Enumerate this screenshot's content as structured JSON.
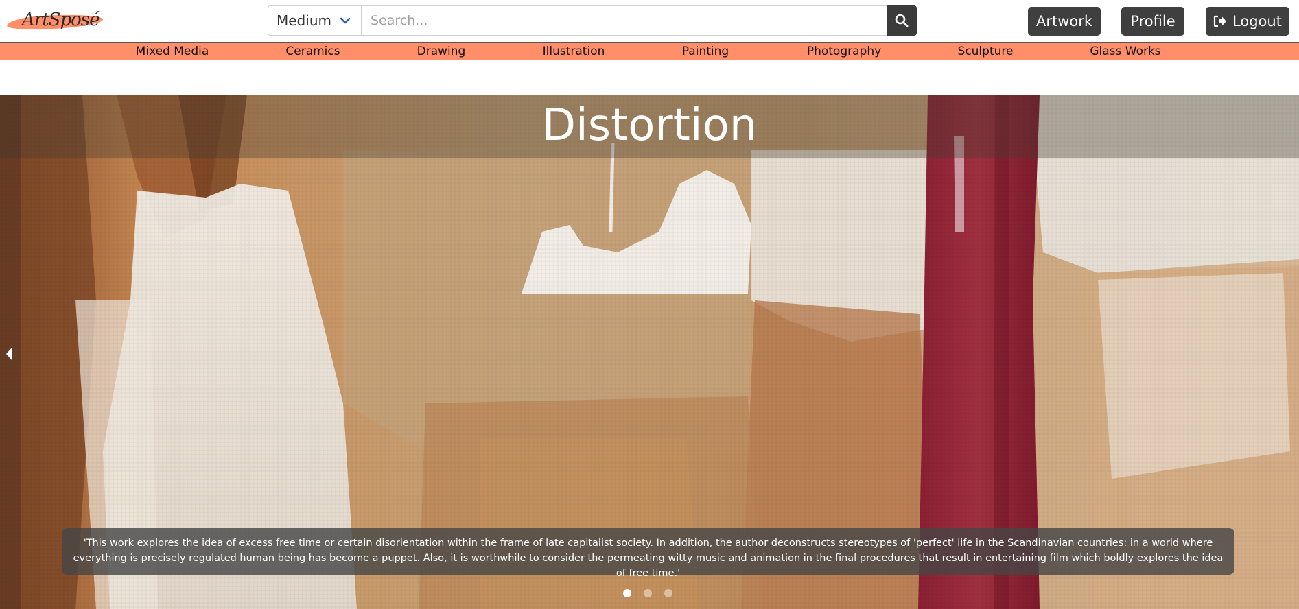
{
  "brand": {
    "logo_text": "ArtSposé"
  },
  "search": {
    "medium_selected": "Medium",
    "placeholder": "Search..."
  },
  "header_buttons": {
    "artwork": "Artwork",
    "profile": "Profile",
    "logout": "Logout"
  },
  "categories": [
    "Mixed Media",
    "Ceramics",
    "Drawing",
    "Illustration",
    "Painting",
    "Photography",
    "Sculpture",
    "Glass Works"
  ],
  "carousel": {
    "title": "Distortion",
    "caption": "'This work explores the idea of excess free time or certain disorientation within the frame of late capitalist society. In addition, the author deconstructs stereotypes of 'perfect' life in the Scandinavian countries: in a world where everything is precisely regulated human being has become a puppet. Also, it is worthwhile to consider the permeating witty music and animation in the final procedures that result in entertaining film which boldly explores the idea of free time.'",
    "slide_count": 3,
    "active_slide": 1
  },
  "colors": {
    "category_bar": "#ff8e69",
    "dark_button": "#3f3f3f",
    "accent_chevron": "#2a62a8"
  },
  "icons": {
    "search": "search-icon",
    "logout": "sign-out-icon",
    "dropdown": "chevron-down-icon",
    "prev": "caret-left-icon"
  }
}
